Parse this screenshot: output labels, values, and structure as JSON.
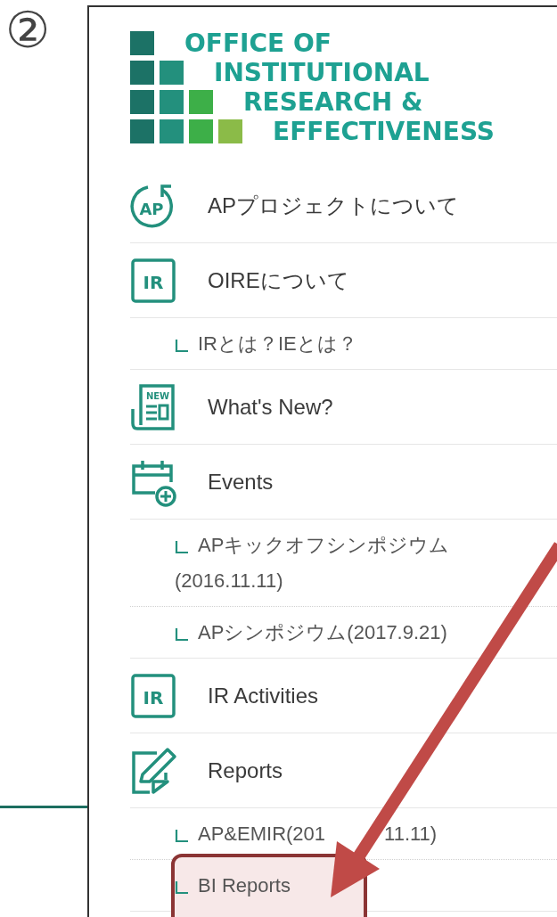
{
  "step_marker": "②",
  "logo": {
    "lines": [
      "OFFICE OF",
      "INSTITUTIONAL",
      "RESEARCH &",
      "EFFECTIVENESS"
    ]
  },
  "nav": {
    "items": [
      {
        "label": "APプロジェクトについて",
        "icon_text": "AP"
      },
      {
        "label": "OIREについて",
        "icon_text": "IR",
        "children": [
          {
            "label": "IRとは？IEとは？",
            "highlighted": false
          }
        ]
      },
      {
        "label": "What's New?",
        "icon_text": "NEW"
      },
      {
        "label": "Events",
        "children": [
          {
            "label": "APキックオフシンポジウム(2016.11.11)",
            "highlighted": false
          },
          {
            "label": "APシンポジウム(2017.9.21)",
            "highlighted": false
          }
        ]
      },
      {
        "label": "IR Activities",
        "icon_text": "IR"
      },
      {
        "label": "Reports",
        "children": [
          {
            "label": "AP&EMIR(201",
            "label_tail": "11.11)",
            "highlighted": false
          },
          {
            "label": "BI Reports",
            "highlighted": true
          }
        ]
      }
    ]
  }
}
